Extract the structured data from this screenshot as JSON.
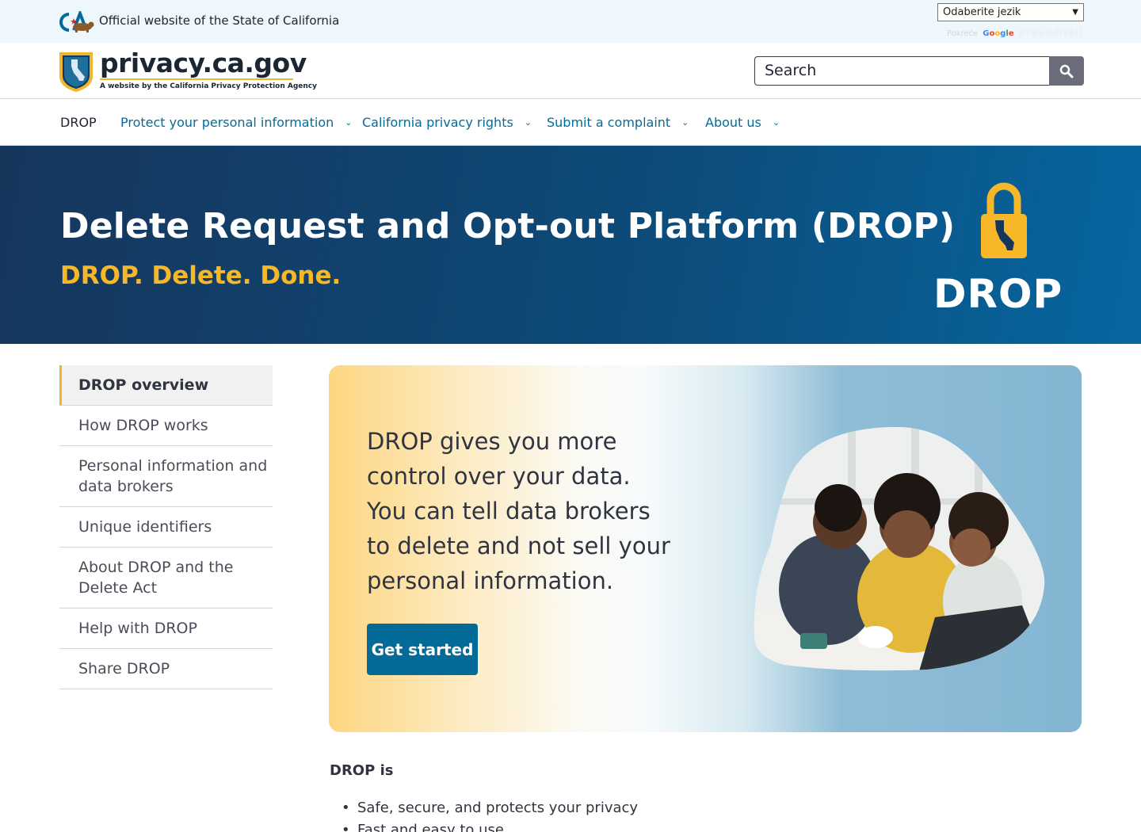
{
  "utility": {
    "official_text": "Official website of the State of California",
    "language_select": "Odaberite jezik",
    "powered_by": "Pokreće",
    "google": "Google",
    "translate": "Prevoditelj"
  },
  "branding": {
    "site_name": "privacy.ca.gov",
    "site_sub": "A website by the California Privacy Protection Agency",
    "search_placeholder": "Search"
  },
  "nav": {
    "items": [
      {
        "label": "DROP"
      },
      {
        "label": "Protect your personal information"
      },
      {
        "label": "California privacy rights"
      },
      {
        "label": "Submit a complaint"
      },
      {
        "label": "About us"
      }
    ]
  },
  "hero": {
    "title": "Delete Request and Opt-out Platform (DROP)",
    "tagline": "DROP. Delete. Done.",
    "logo_text": "DROP"
  },
  "sidenav": {
    "items": [
      {
        "label": "DROP overview"
      },
      {
        "label": "How DROP works"
      },
      {
        "label": "Personal information and data brokers"
      },
      {
        "label": "Unique identifiers"
      },
      {
        "label": "About DROP and the Delete Act"
      },
      {
        "label": "Help with DROP"
      },
      {
        "label": "Share DROP"
      }
    ]
  },
  "card": {
    "lead": "DROP gives you more control over your data. You can tell data brokers to delete and not sell your personal information.",
    "cta": "Get started"
  },
  "content": {
    "heading": "DROP is",
    "bullets": [
      "Safe, secure, and protects your privacy",
      "Fast and easy to use"
    ]
  },
  "colors": {
    "accent_gold": "#f2b428",
    "link_blue": "#046b99",
    "hero_dark": "#16365c"
  }
}
